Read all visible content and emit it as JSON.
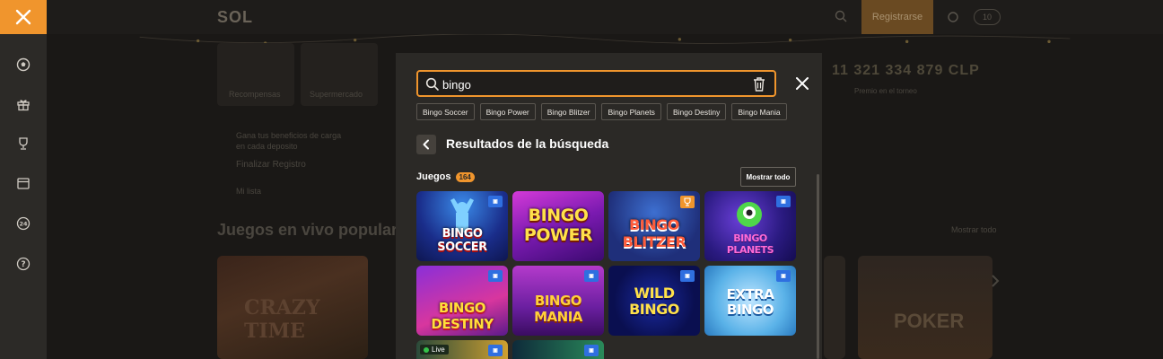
{
  "header": {
    "logo": "SOL",
    "register_label": "Registrarse",
    "balance_label": "10"
  },
  "sidebar": {
    "items": [
      {
        "icon": "soccer-ball-icon"
      },
      {
        "icon": "gift-icon"
      },
      {
        "icon": "trophy-icon"
      },
      {
        "icon": "calendar-icon"
      },
      {
        "icon": "support-24-icon"
      },
      {
        "icon": "help-icon"
      }
    ]
  },
  "background": {
    "tiles": [
      "Recompensas",
      "Supermercado"
    ],
    "promo_line1": "Gana tus beneficios de carga",
    "promo_line2": "en cada deposito",
    "promo_link": "Finalizar Registro",
    "jackpot_amount": "11 321 334 879 CLP",
    "jackpot_caption": "Premio en el torneo",
    "live_heading": "Juegos en vivo popular",
    "see_all": "Mostrar todo",
    "bottom_link": "Mi lista",
    "thumb_crazy": "CRAZY TIME",
    "thumb_poker": "POKER"
  },
  "search": {
    "query": "bingo",
    "suggestions": [
      "Bingo Soccer",
      "Bingo Power",
      "Bingo Blitzer",
      "Bingo Planets",
      "Bingo Destiny",
      "Bingo Mania"
    ]
  },
  "results": {
    "title": "Resultados de la búsqueda",
    "games_label": "Juegos",
    "games_count": "164",
    "show_all_label": "Mostrar todo",
    "live_label": "Live",
    "games": [
      {
        "title": "BINGO SOCCER",
        "badge": "provider"
      },
      {
        "title": "BINGO POWER",
        "badge": "none"
      },
      {
        "title": "BINGO BLITZER",
        "badge": "trophy"
      },
      {
        "title": "BINGO PLANETS",
        "badge": "provider"
      },
      {
        "title": "BINGO DESTINY",
        "badge": "provider"
      },
      {
        "title": "BINGO MANIA",
        "badge": "provider"
      },
      {
        "title": "WILD BINGO",
        "badge": "provider"
      },
      {
        "title": "EXTRA BINGO",
        "badge": "provider"
      }
    ]
  },
  "colors": {
    "accent": "#f0952d",
    "modal_bg": "#2b2926",
    "sidebar_bg": "#2c2a27",
    "provider_badge": "#2f6fe0"
  }
}
